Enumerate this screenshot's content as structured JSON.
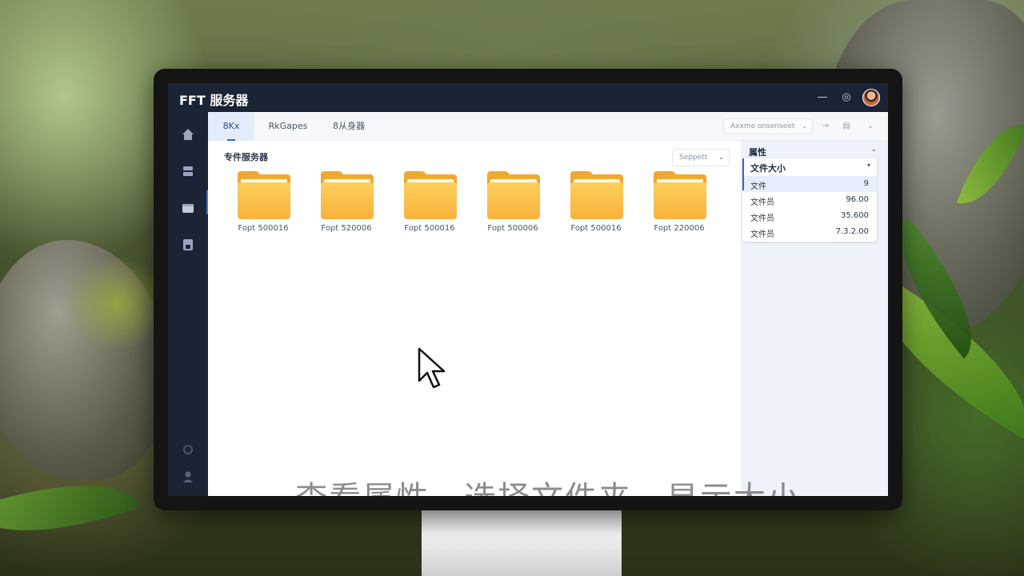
{
  "app": {
    "title": "FFT 服务器"
  },
  "window_controls": {
    "minimize": "—",
    "help": "◎"
  },
  "tabs": [
    {
      "label": "8Kx",
      "active": true
    },
    {
      "label": "RkGapes",
      "active": false
    },
    {
      "label": "8从身器",
      "active": false
    }
  ],
  "toolbar": {
    "select_placeholder": "Axxme onsenseet"
  },
  "section": {
    "title": "专件服务器",
    "search_placeholder": "Seppett"
  },
  "folders": [
    {
      "label": "Fopt 500016"
    },
    {
      "label": "Fopt 520006"
    },
    {
      "label": "Fopt 500016"
    },
    {
      "label": "Fopt 500006"
    },
    {
      "label": "Fopt 500016"
    },
    {
      "label": "Fopt 220006"
    }
  ],
  "properties": {
    "header": "属性",
    "dropdown": "文件大小",
    "rows": [
      {
        "key": "文件",
        "value": "9",
        "selected": true
      },
      {
        "key": "文件员",
        "value": "96.00",
        "selected": false
      },
      {
        "key": "文件员",
        "value": "35.600",
        "selected": false
      },
      {
        "key": "文件员",
        "value": "7.3.2.00",
        "selected": false
      }
    ]
  },
  "caption": {
    "part1": "查看属性",
    "part2": "选择文件夹",
    "part3": "显示大小"
  },
  "colors": {
    "sidebar_bg": "#1b2435",
    "accent": "#2f66d6",
    "folder": "#f7b23c"
  }
}
